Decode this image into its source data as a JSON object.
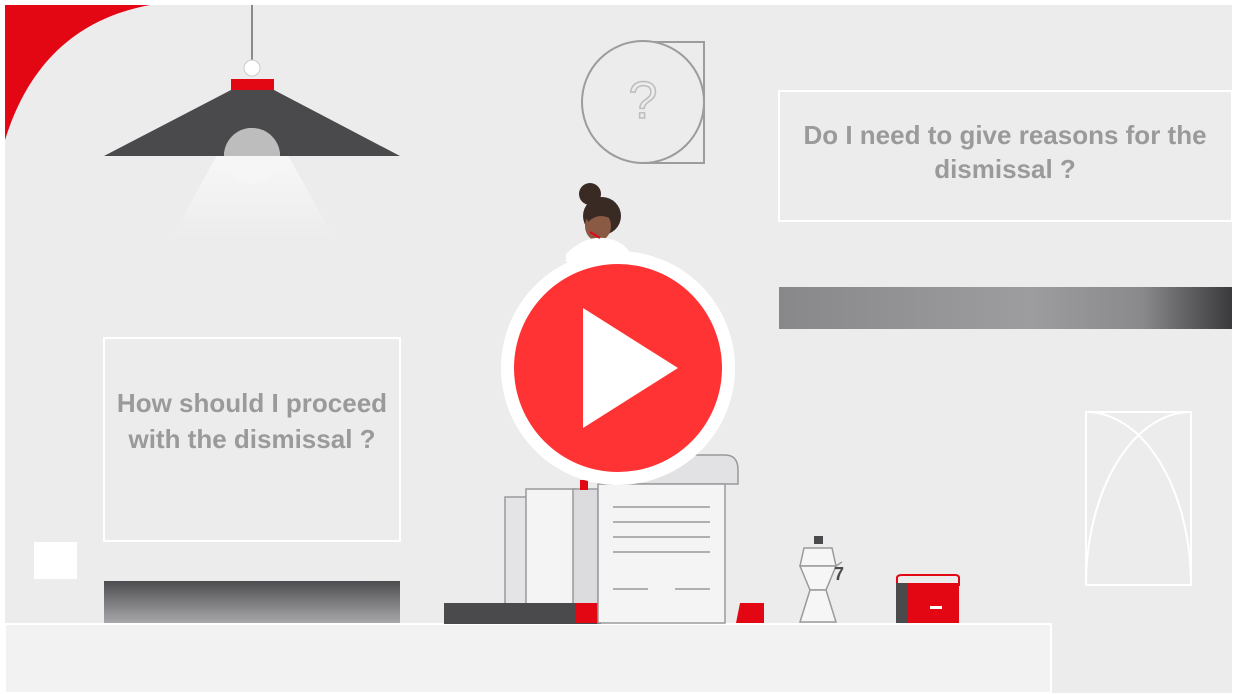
{
  "video": {
    "caption_right": "Do I need to give reasons for the dismissal ?",
    "caption_left": "How should I proceed with the dismissal ?",
    "question_mark": "?",
    "mug_number": "7",
    "play_icon": "play-icon"
  },
  "colors": {
    "background": "#ececed",
    "accent_red": "#e30613",
    "play_red": "#ff3333",
    "caption_gray": "#9a9a9a",
    "dark_gray": "#4a4a4d"
  }
}
